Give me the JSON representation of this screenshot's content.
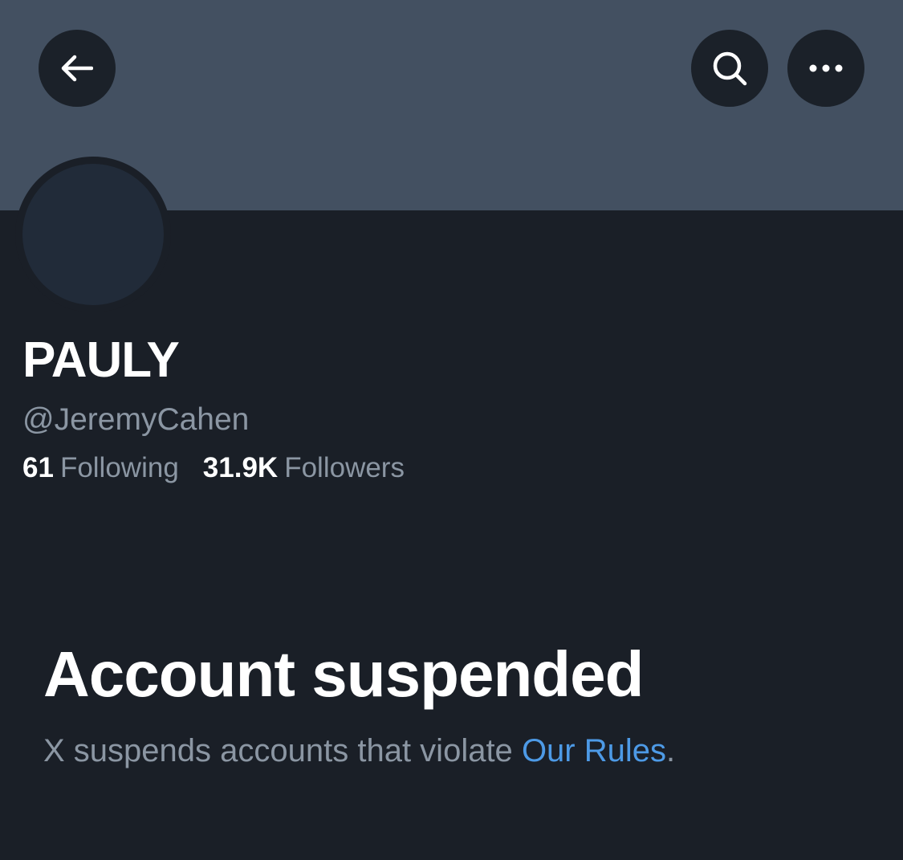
{
  "header": {
    "back_icon": "arrow-left-icon",
    "search_icon": "search-icon",
    "more_icon": "more-horizontal-icon"
  },
  "profile": {
    "name": "PAULY",
    "handle": "@JeremyCahen",
    "following_count": "61",
    "following_label": "Following",
    "followers_count": "31.9K",
    "followers_label": "Followers"
  },
  "suspension": {
    "title": "Account suspended",
    "message": "X suspends accounts that violate",
    "link_text": "Our Rules",
    "trailing": "."
  },
  "colors": {
    "background": "#1a1f27",
    "banner": "#435061",
    "avatar": "#212b39",
    "muted_text": "#8b96a3",
    "link": "#4d9ae6"
  }
}
